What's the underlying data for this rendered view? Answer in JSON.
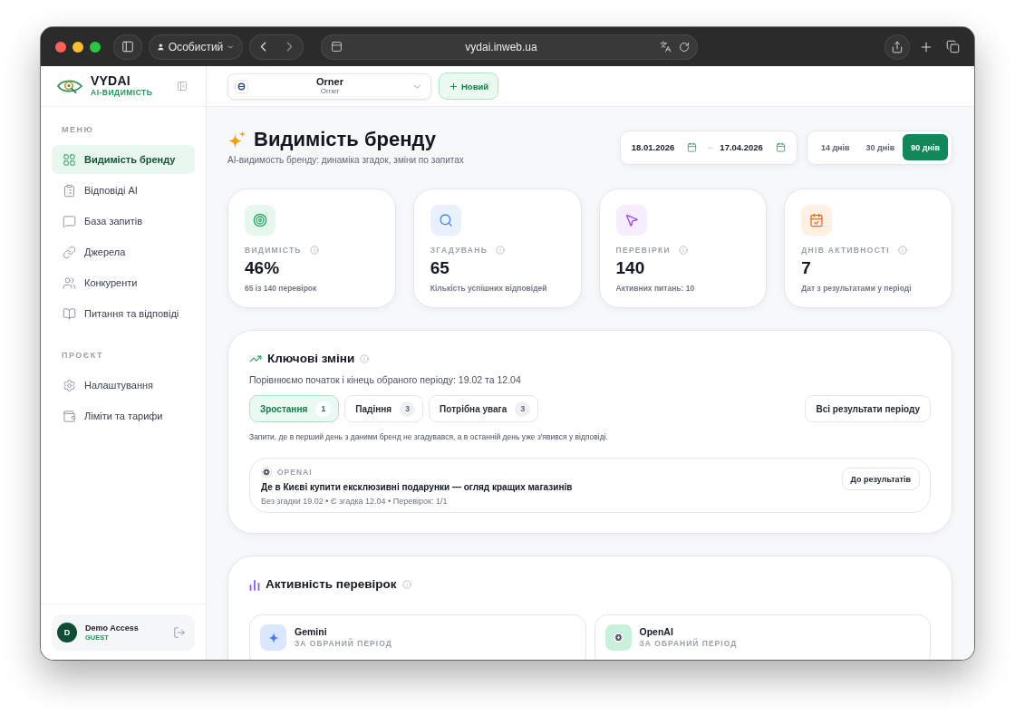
{
  "browser": {
    "profile": "Особистий",
    "url": "vydai.inweb.ua"
  },
  "sidebar": {
    "brand": "VYDAI",
    "tagline": "AI-ВИДИМІСТЬ",
    "sections": [
      {
        "title": "МЕНЮ",
        "items": [
          {
            "label": "Видимість бренду",
            "selected": true
          },
          {
            "label": "Відповіді AI",
            "selected": false
          },
          {
            "label": "База запитів",
            "selected": false
          },
          {
            "label": "Джерела",
            "selected": false
          },
          {
            "label": "Конкуренти",
            "selected": false
          },
          {
            "label": "Питання та відповіді",
            "selected": false
          }
        ]
      },
      {
        "title": "ПРОЄКТ",
        "items": [
          {
            "label": "Налаштування",
            "selected": false
          },
          {
            "label": "Ліміти та тарифи",
            "selected": false
          }
        ]
      }
    ],
    "user": {
      "initial": "D",
      "name": "Demo Access",
      "role": "GUEST"
    }
  },
  "topbar": {
    "project": {
      "name": "Orner",
      "subtitle": "Orner"
    },
    "new_button": "Новий"
  },
  "page": {
    "title": "Видимість бренду",
    "subtitle": "AI-видимость бренду: динаміка згадок, зміни по запитах",
    "date_from": "18.01.2026",
    "range_separator": "–",
    "date_to": "17.04.2026",
    "periods": [
      {
        "label": "14 днів",
        "selected": false
      },
      {
        "label": "30 днів",
        "selected": false
      },
      {
        "label": "90 днів",
        "selected": true
      }
    ]
  },
  "stats": [
    {
      "label": "ВИДИМІСТЬ",
      "value": "46%",
      "note": "65 із 140 перевірок"
    },
    {
      "label": "ЗГАДУВАНЬ",
      "value": "65",
      "note": "Кількість успішних відповідей"
    },
    {
      "label": "ПЕРЕВІРКИ",
      "value": "140",
      "note": "Активних питань: 10"
    },
    {
      "label": "ДНІВ АКТИВНОСТІ",
      "value": "7",
      "note": "Дат з результатами у періоді"
    }
  ],
  "key_changes": {
    "title": "Ключові зміни",
    "description": "Порівнюємо початок і кінець обраного періоду: 19.02 та 12.04",
    "tabs": [
      {
        "label": "Зростання",
        "count": "1",
        "selected": true
      },
      {
        "label": "Падіння",
        "count": "3",
        "selected": false
      },
      {
        "label": "Потрібна увага",
        "count": "3",
        "selected": false
      }
    ],
    "all_button": "Всі результати періоду",
    "hint": "Запити, де в перший день з даними бренд не згадувався, а в останній день уже з'явився у відповіді.",
    "results": [
      {
        "provider": "OPENAI",
        "query": "Де в Києві купити ексклюзивні подарунки — огляд кращих магазинів",
        "meta": "Без згадки 19.02 • Є згадка 12.04 • Перевірок: 1/1",
        "button": "До результатів"
      }
    ]
  },
  "activity": {
    "title": "Активність перевірок",
    "providers": [
      {
        "name": "Gemini",
        "note": "ЗА ОБРАНИЙ ПЕРІОД"
      },
      {
        "name": "OpenAI",
        "note": "ЗА ОБРАНИЙ ПЕРІОД"
      }
    ]
  }
}
